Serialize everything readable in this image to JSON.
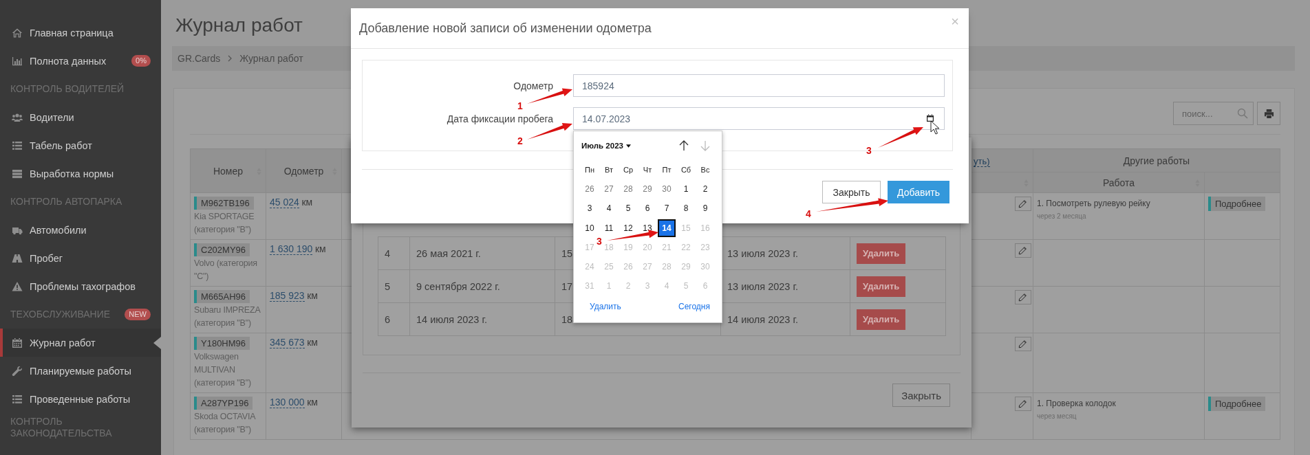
{
  "sidebar": {
    "items": [
      {
        "kind": "link",
        "label": "Главная страница",
        "selected": false
      },
      {
        "kind": "link",
        "label": "Полнота данных",
        "badge": "0%",
        "selected": false
      },
      {
        "kind": "heading",
        "label": "КОНТРОЛЬ ВОДИТЕЛЕЙ"
      },
      {
        "kind": "link",
        "label": "Водители",
        "selected": false
      },
      {
        "kind": "link",
        "label": "Табель работ",
        "selected": false
      },
      {
        "kind": "link",
        "label": "Выработка нормы",
        "selected": false
      },
      {
        "kind": "heading",
        "label": "КОНТРОЛЬ АВТОПАРКА"
      },
      {
        "kind": "link",
        "label": "Автомобили",
        "selected": false
      },
      {
        "kind": "link",
        "label": "Пробег",
        "selected": false
      },
      {
        "kind": "link",
        "label": "Проблемы тахографов",
        "selected": false
      },
      {
        "kind": "heading",
        "label": "ТЕХОБСЛУЖИВАНИЕ",
        "badge": "NEW"
      },
      {
        "kind": "link",
        "label": "Журнал работ",
        "selected": true
      },
      {
        "kind": "link",
        "label": "Планируемые работы",
        "selected": false
      },
      {
        "kind": "link",
        "label": "Проведенные работы",
        "selected": false
      },
      {
        "kind": "heading",
        "label": "КОНТРОЛЬ ЗАКОНОДАТЕЛЬСТВА"
      }
    ]
  },
  "page": {
    "title": "Журнал работ",
    "breadcrumb": [
      "GR.Cards",
      "Журнал работ"
    ]
  },
  "toolbar": {
    "search": {
      "placeholder": "поиск..."
    }
  },
  "table": {
    "columns": [
      "Номер",
      "Одометр"
    ],
    "header_link": "уть)",
    "group_header": "Другие работы",
    "work_column": "Работа",
    "rows": [
      {
        "plate": "M962TB196",
        "car": "Kia SPORTAGE (категория \"B\")",
        "odometer": "45 024",
        "unit": "км",
        "work": "1. Посмотреть рулевую рейку",
        "work_due": "через 2 месяца",
        "details": "Подробнее"
      },
      {
        "plate": "C202MY96",
        "car": "Volvo (категория \"C\")",
        "odometer": "1 630 190",
        "unit": "км"
      },
      {
        "plate": "M665AH96",
        "car": "Subaru IMPREZA (категория \"B\")",
        "odometer": "185 923",
        "unit": "км"
      },
      {
        "plate": "Y180HM96",
        "car": "Volkswagen MULTIVAN (категория \"B\")",
        "odometer": "345 673",
        "unit": "км"
      },
      {
        "plate": "A287YP196",
        "car": "Skoda OCTAVIA (категория \"B\")",
        "odometer": "130 000",
        "unit": "км",
        "work": "1. Проверка колодок",
        "work_due": "через месяц",
        "details": "Подробнее"
      }
    ]
  },
  "history_dialog": {
    "rows": [
      {
        "number": "4",
        "date": "26 мая 2021 г.",
        "column_3": "15",
        "changed": "13 июля 2023 г.",
        "action": "Удалить"
      },
      {
        "number": "5",
        "date": "9 сентября 2022 г.",
        "column_3": "17",
        "changed": "13 июля 2023 г.",
        "action": "Удалить"
      },
      {
        "number": "6",
        "date": "14 июля 2023 г.",
        "column_3": "18",
        "changed": "14 июля 2023 г.",
        "action": "Удалить"
      }
    ],
    "close": "Закрыть"
  },
  "dialog": {
    "title": "Добавление новой записи об изменении одометра",
    "close": "×",
    "fields": [
      {
        "label": "Одометр",
        "value": "185924",
        "kind": "text"
      },
      {
        "label": "Дата фиксации пробега",
        "value": "14.07.2023",
        "kind": "date"
      }
    ],
    "buttons": [
      {
        "label": "Закрыть",
        "kind": "default"
      },
      {
        "label": "Добавить",
        "kind": "primary"
      }
    ]
  },
  "datepicker": {
    "month": "Июль 2023",
    "weekdays": [
      "Пн",
      "Вт",
      "Ср",
      "Чт",
      "Пт",
      "Сб",
      "Вс"
    ],
    "weeks": [
      [
        {
          "day": "26",
          "kind": "outside",
          "selected": false
        },
        {
          "day": "27",
          "kind": "outside",
          "selected": false
        },
        {
          "day": "28",
          "kind": "outside",
          "selected": false
        },
        {
          "day": "29",
          "kind": "outside",
          "selected": false
        },
        {
          "day": "30",
          "kind": "outside",
          "selected": false
        },
        {
          "day": "1",
          "kind": "normal",
          "selected": false
        },
        {
          "day": "2",
          "kind": "normal",
          "selected": false
        }
      ],
      [
        {
          "day": "3",
          "kind": "normal",
          "selected": false
        },
        {
          "day": "4",
          "kind": "normal",
          "selected": false
        },
        {
          "day": "5",
          "kind": "normal",
          "selected": false
        },
        {
          "day": "6",
          "kind": "normal",
          "selected": false
        },
        {
          "day": "7",
          "kind": "normal",
          "selected": false
        },
        {
          "day": "8",
          "kind": "normal",
          "selected": false
        },
        {
          "day": "9",
          "kind": "normal",
          "selected": false
        }
      ],
      [
        {
          "day": "10",
          "kind": "normal",
          "selected": false
        },
        {
          "day": "11",
          "kind": "normal",
          "selected": false
        },
        {
          "day": "12",
          "kind": "normal",
          "selected": false
        },
        {
          "day": "13",
          "kind": "normal",
          "selected": false
        },
        {
          "day": "14",
          "kind": "normal",
          "selected": true
        },
        {
          "day": "15",
          "kind": "disabled",
          "selected": false
        },
        {
          "day": "16",
          "kind": "disabled",
          "selected": false
        }
      ],
      [
        {
          "day": "17",
          "kind": "disabled",
          "selected": false
        },
        {
          "day": "18",
          "kind": "disabled",
          "selected": false
        },
        {
          "day": "19",
          "kind": "disabled",
          "selected": false
        },
        {
          "day": "20",
          "kind": "disabled",
          "selected": false
        },
        {
          "day": "21",
          "kind": "disabled",
          "selected": false
        },
        {
          "day": "22",
          "kind": "disabled",
          "selected": false
        },
        {
          "day": "23",
          "kind": "disabled",
          "selected": false
        }
      ],
      [
        {
          "day": "24",
          "kind": "disabled",
          "selected": false
        },
        {
          "day": "25",
          "kind": "disabled",
          "selected": false
        },
        {
          "day": "26",
          "kind": "disabled",
          "selected": false
        },
        {
          "day": "27",
          "kind": "disabled",
          "selected": false
        },
        {
          "day": "28",
          "kind": "disabled",
          "selected": false
        },
        {
          "day": "29",
          "kind": "disabled",
          "selected": false
        },
        {
          "day": "30",
          "kind": "disabled",
          "selected": false
        }
      ],
      [
        {
          "day": "31",
          "kind": "disabled",
          "selected": false
        },
        {
          "day": "1",
          "kind": "disabled",
          "selected": false
        },
        {
          "day": "2",
          "kind": "disabled",
          "selected": false
        },
        {
          "day": "3",
          "kind": "disabled",
          "selected": false
        },
        {
          "day": "4",
          "kind": "disabled",
          "selected": false
        },
        {
          "day": "5",
          "kind": "disabled",
          "selected": false
        },
        {
          "day": "6",
          "kind": "disabled",
          "selected": false
        }
      ]
    ],
    "clear": "Удалить",
    "today": "Сегодня"
  },
  "annotations": [
    {
      "label": "1"
    },
    {
      "label": "2"
    },
    {
      "label": "3"
    },
    {
      "label": "4"
    },
    {
      "label": "3"
    }
  ]
}
